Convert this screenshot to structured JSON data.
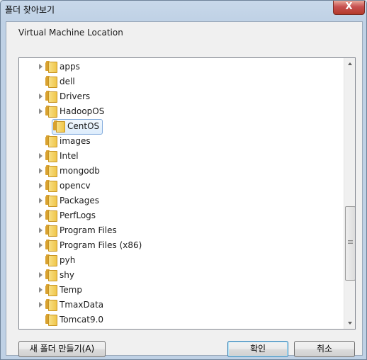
{
  "window": {
    "title": "폴더 찾아보기",
    "close_glyph": "X"
  },
  "dialog": {
    "description": "Virtual Machine Location"
  },
  "tree": {
    "items": [
      {
        "label": "apps",
        "has_children": true,
        "selected": false,
        "indent": 1
      },
      {
        "label": "dell",
        "has_children": false,
        "selected": false,
        "indent": 1
      },
      {
        "label": "Drivers",
        "has_children": true,
        "selected": false,
        "indent": 1
      },
      {
        "label": "HadoopOS",
        "has_children": true,
        "selected": false,
        "indent": 1
      },
      {
        "label": "CentOS",
        "has_children": false,
        "selected": true,
        "indent": 2
      },
      {
        "label": "images",
        "has_children": false,
        "selected": false,
        "indent": 1
      },
      {
        "label": "Intel",
        "has_children": true,
        "selected": false,
        "indent": 1
      },
      {
        "label": "mongodb",
        "has_children": true,
        "selected": false,
        "indent": 1
      },
      {
        "label": "opencv",
        "has_children": true,
        "selected": false,
        "indent": 1
      },
      {
        "label": "Packages",
        "has_children": true,
        "selected": false,
        "indent": 1
      },
      {
        "label": "PerfLogs",
        "has_children": true,
        "selected": false,
        "indent": 1
      },
      {
        "label": "Program Files",
        "has_children": true,
        "selected": false,
        "indent": 1
      },
      {
        "label": "Program Files (x86)",
        "has_children": true,
        "selected": false,
        "indent": 1
      },
      {
        "label": "pyh",
        "has_children": false,
        "selected": false,
        "indent": 1
      },
      {
        "label": "shy",
        "has_children": true,
        "selected": false,
        "indent": 1
      },
      {
        "label": "Temp",
        "has_children": true,
        "selected": false,
        "indent": 1
      },
      {
        "label": "TmaxData",
        "has_children": true,
        "selected": false,
        "indent": 1
      },
      {
        "label": "Tomcat9.0",
        "has_children": false,
        "selected": false,
        "indent": 1
      }
    ]
  },
  "buttons": {
    "new_folder": "새 폴더 만들기(A)",
    "ok": "확인",
    "cancel": "취소"
  }
}
